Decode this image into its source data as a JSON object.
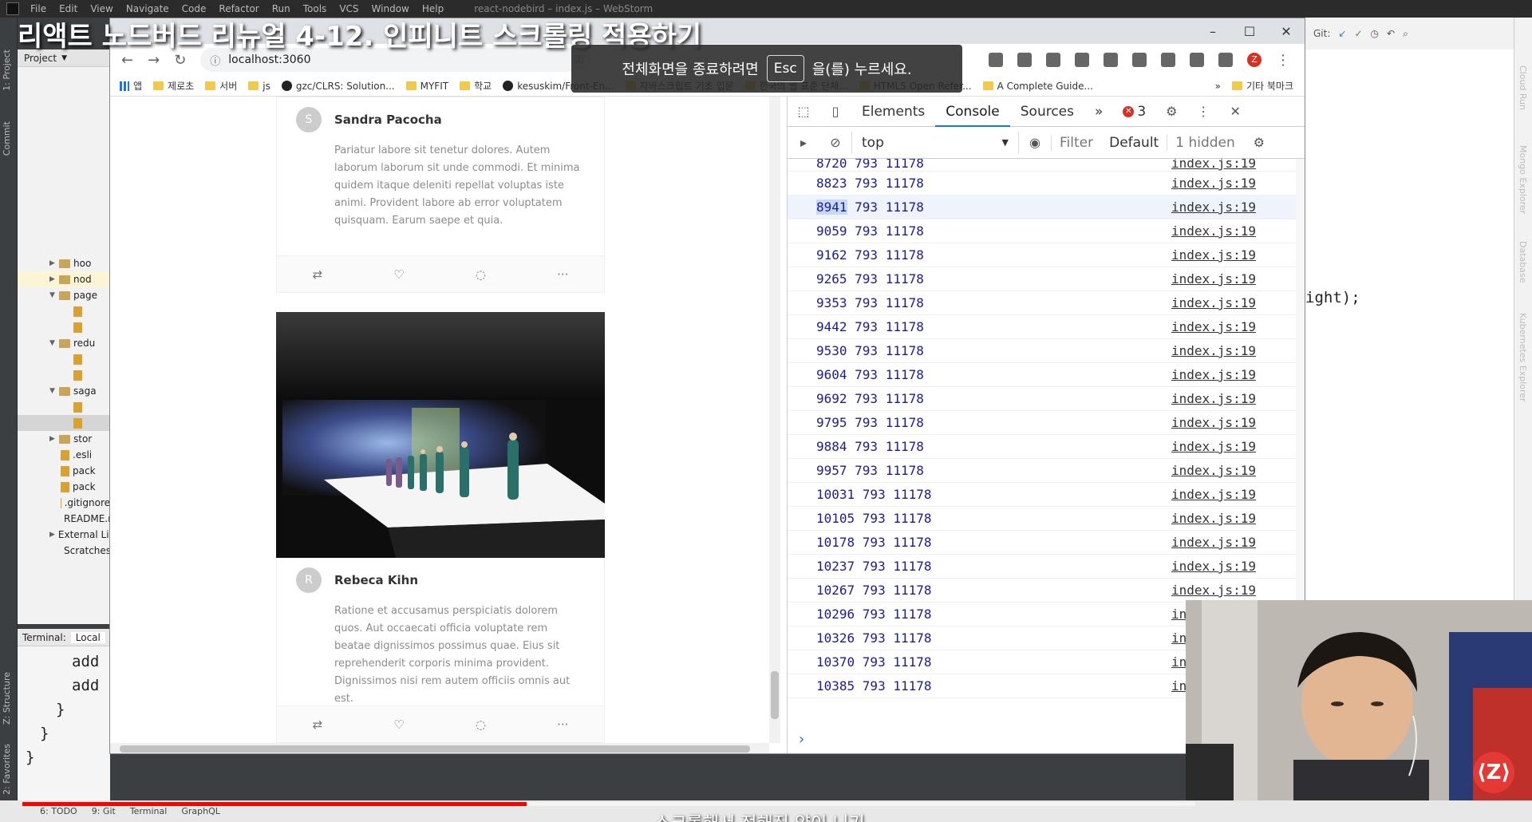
{
  "video": {
    "title": "리액트 노드버드 리뉴얼 4-12. 인피니트 스크롤링 적용하기",
    "subtitle": "스크롤해서 정해진 양이 니기",
    "progress": 0.43
  },
  "ide": {
    "menu": [
      "File",
      "Edit",
      "View",
      "Navigate",
      "Code",
      "Refactor",
      "Run",
      "Tools",
      "VCS",
      "Window",
      "Help"
    ],
    "window_title": "react-nodebird – index.js – WebStorm",
    "project_label": "Project",
    "tree": [
      {
        "label": "hoo",
        "kind": "folder",
        "state": "collapsed"
      },
      {
        "label": "nod",
        "kind": "folder",
        "state": "collapsed",
        "highlight": "yellow"
      },
      {
        "label": "page",
        "kind": "folder",
        "state": "expanded"
      },
      {
        "label": "redu",
        "kind": "folder",
        "state": "expanded"
      },
      {
        "label": "saga",
        "kind": "folder",
        "state": "expanded"
      },
      {
        "label": "stor",
        "kind": "folder",
        "state": "collapsed"
      },
      {
        "label": ".esli",
        "kind": "file"
      },
      {
        "label": "pack",
        "kind": "file"
      },
      {
        "label": "pack",
        "kind": "file"
      },
      {
        "label": ".gitignore",
        "kind": "file"
      },
      {
        "label": "README.m",
        "kind": "file"
      },
      {
        "label": "External Librar",
        "kind": "folder",
        "state": "collapsed"
      },
      {
        "label": "Scratches and",
        "kind": "file"
      }
    ],
    "terminal_tabs": [
      "Terminal:",
      "Local"
    ],
    "terminal_lines": [
      "add",
      "add",
      "}",
      "}",
      "}"
    ],
    "editor_snippet": "ight);",
    "left_tabs": [
      "1: Project",
      "Commit",
      "Z: Structure",
      "2: Favorites"
    ],
    "right_tabs": [
      "Cloud Run",
      "Mongo Explorer",
      "Database",
      "Kubernetes Explorer"
    ],
    "git_label": "Git:",
    "status_items": [
      "6: TODO",
      "9: Git",
      "Terminal",
      "GraphQL"
    ]
  },
  "browser": {
    "url": "localhost:3060",
    "fullscreen_notice": {
      "before": "전체화면을 종료하려면",
      "key": "Esc",
      "after": "을(를) 누르세요."
    },
    "bookmarks": [
      {
        "label": "앱",
        "icon": "apps"
      },
      {
        "label": "제로초",
        "icon": "folder"
      },
      {
        "label": "서버",
        "icon": "folder"
      },
      {
        "label": "js",
        "icon": "folder"
      },
      {
        "label": "gzc/CLRS: Solution...",
        "icon": "github"
      },
      {
        "label": "MYFIT",
        "icon": "folder"
      },
      {
        "label": "학교",
        "icon": "folder"
      },
      {
        "label": "kesuskim/Front-En...",
        "icon": "github"
      },
      {
        "label": "자바스크립트 기초 입문",
        "icon": "sheet"
      },
      {
        "label": "한국의 웹 표준 단체...",
        "icon": "bookmark"
      },
      {
        "label": "HTML5 Open Refer...",
        "icon": "bookmark"
      },
      {
        "label": "A Complete Guide...",
        "icon": "bookmark"
      }
    ],
    "bookmarks_more": "»",
    "other_bookmarks": "기타 북마크"
  },
  "posts": [
    {
      "avatar": "S",
      "author": "Sandra Pacocha",
      "body": "Pariatur labore sit tenetur dolores. Autem laborum laborum sit unde commodi. Et minima quidem itaque deleniti repellat voluptas iste animi. Provident labore ab error voluptatem quisquam. Earum saepe et quia."
    },
    {
      "avatar": "R",
      "author": "Rebeca Kihn",
      "body": "Ratione et accusamus perspiciatis dolorem quos. Aut occaecati officia voluptate rem beatae dignissimos possimus quae. Eius sit reprehenderit corporis minima provident. Dignissimos nisi rem autem officiis omnis aut est."
    }
  ],
  "post_actions": [
    "retweet-icon",
    "heart-icon",
    "comment-icon",
    "ellipsis-icon"
  ],
  "devtools": {
    "tabs": [
      "Elements",
      "Console",
      "Sources"
    ],
    "active_tab": "Console",
    "more": "»",
    "error_count": "3",
    "context": "top",
    "filter_placeholder": "Filter",
    "levels": "Default",
    "hidden": "1 hidden",
    "source": "index.js:19",
    "logs": [
      "8720 793 11178",
      "8823 793 11178",
      "8941 793 11178",
      "9059 793 11178",
      "9162 793 11178",
      "9265 793 11178",
      "9353 793 11178",
      "9442 793 11178",
      "9530 793 11178",
      "9604 793 11178",
      "9692 793 11178",
      "9795 793 11178",
      "9884 793 11178",
      "9957 793 11178",
      "10031 793 11178",
      "10105 793 11178",
      "10178 793 11178",
      "10237 793 11178",
      "10267 793 11178",
      "10296 793 11178",
      "10326 793 11178",
      "10370 793 11178",
      "10385 793 11178"
    ],
    "selected_text": "8941",
    "prompt": "›"
  },
  "webcam": {
    "logo": "⟨Z⟩"
  }
}
